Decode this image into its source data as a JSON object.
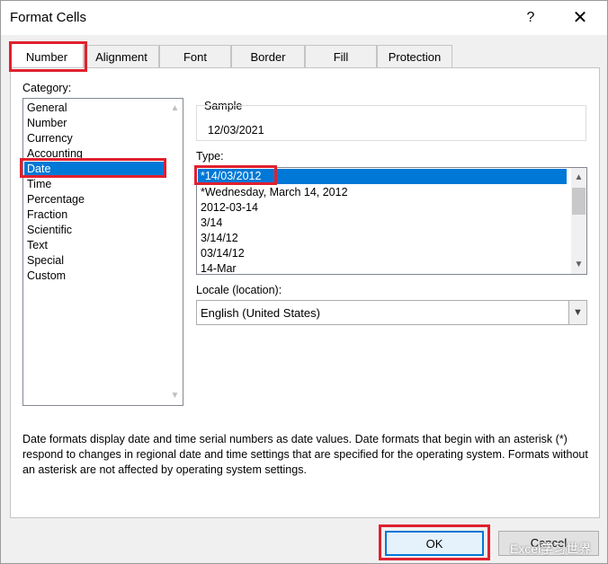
{
  "window": {
    "title": "Format Cells",
    "help": "?",
    "close": "✕"
  },
  "tabs": [
    {
      "label": "Number"
    },
    {
      "label": "Alignment"
    },
    {
      "label": "Font"
    },
    {
      "label": "Border"
    },
    {
      "label": "Fill"
    },
    {
      "label": "Protection"
    }
  ],
  "category": {
    "label": "Category:",
    "items": [
      "General",
      "Number",
      "Currency",
      "Accounting",
      "Date",
      "Time",
      "Percentage",
      "Fraction",
      "Scientific",
      "Text",
      "Special",
      "Custom"
    ],
    "selected": "Date"
  },
  "sample": {
    "label": "Sample",
    "value": "12/03/2021"
  },
  "type": {
    "label": "Type:",
    "items": [
      "*14/03/2012",
      "*Wednesday, March 14, 2012",
      "2012-03-14",
      "3/14",
      "3/14/12",
      "03/14/12",
      "14-Mar"
    ],
    "selected": "*14/03/2012"
  },
  "locale": {
    "label": "Locale (location):",
    "value": "English (United States)"
  },
  "description": "Date formats display date and time serial numbers as date values.  Date formats that begin with an asterisk (*) respond to changes in regional date and time settings that are specified for the operating system. Formats without an asterisk are not affected by operating system settings.",
  "buttons": {
    "ok": "OK",
    "cancel": "Cancel"
  },
  "watermark": "Excel学习世界",
  "colors": {
    "selection": "#0078d7",
    "highlight_box": "#e0202e"
  }
}
